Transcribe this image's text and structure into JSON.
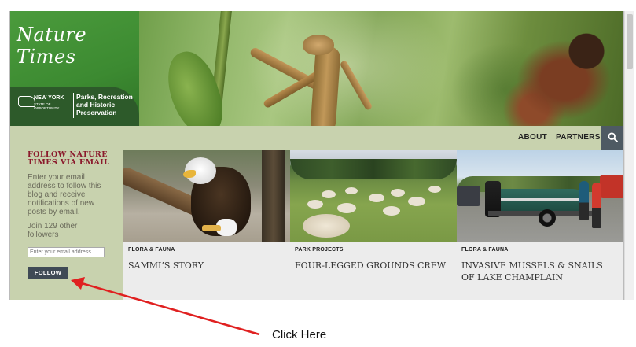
{
  "site": {
    "title": "Nature Times",
    "state_name": "NEW YORK",
    "state_tagline": "STATE OF OPPORTUNITY",
    "agency": "Parks, Recreation and Historic Preservation"
  },
  "nav": {
    "items": [
      {
        "label": "ABOUT"
      },
      {
        "label": "PARTNERS"
      }
    ],
    "search_icon": "search-icon"
  },
  "sidebar": {
    "heading": "FOLLOW NATURE TIMES VIA EMAIL",
    "description": "Enter your email address to follow this blog and receive notifications of new posts by email.",
    "followers": "Join 129 other followers",
    "email_placeholder": "Enter your email address",
    "follow_label": "FOLLOW"
  },
  "posts": [
    {
      "category": "FLORA & FAUNA",
      "title": "SAMMI’S STORY"
    },
    {
      "category": "PARK PROJECTS",
      "title": "FOUR-LEGGED GROUNDS CREW"
    },
    {
      "category": "FLORA & FAUNA",
      "title": "INVASIVE MUSSELS & SNAILS OF LAKE CHAMPLAIN"
    }
  ],
  "annotation": {
    "text": "Click Here",
    "color": "#e02020"
  }
}
